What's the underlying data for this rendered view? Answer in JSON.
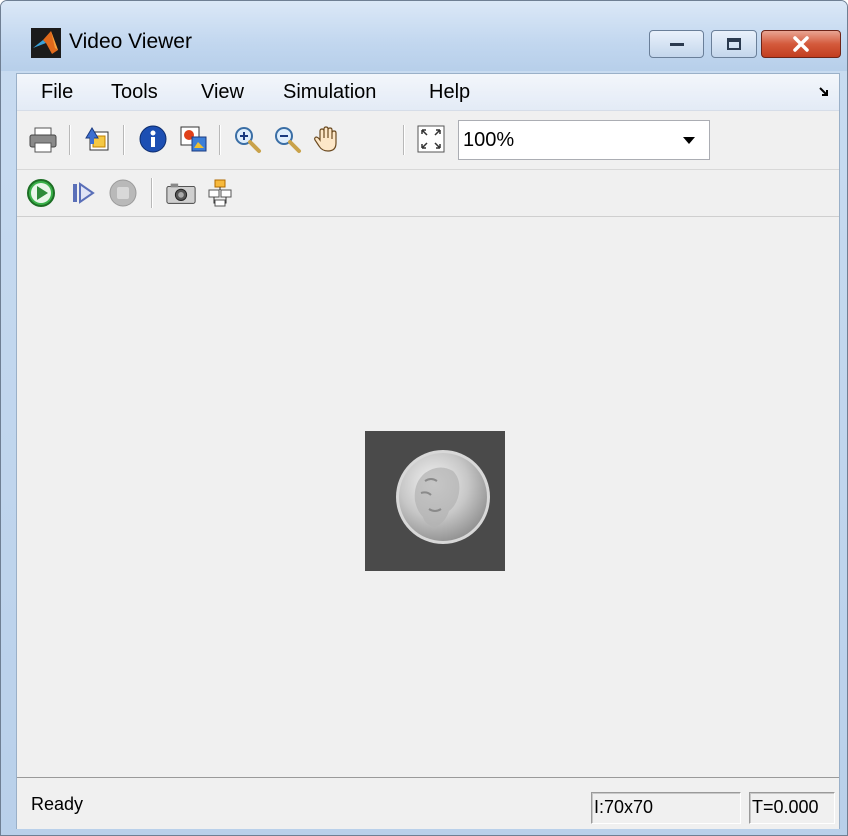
{
  "window": {
    "title": "Video Viewer",
    "minimize_icon": "minimize-icon",
    "maximize_icon": "maximize-icon",
    "close_icon": "close-icon"
  },
  "menu": {
    "items": [
      "File",
      "Tools",
      "View",
      "Simulation",
      "Help"
    ]
  },
  "toolbar": {
    "icons": [
      "print-icon",
      "parameters-icon",
      "info-icon",
      "export-image-icon",
      "zoom-in-icon",
      "zoom-out-icon",
      "pan-hand-icon",
      "fit-to-view-icon"
    ],
    "zoom_value": "100%"
  },
  "playback": {
    "icons": [
      "play-icon",
      "step-forward-icon",
      "stop-icon",
      "snapshot-icon",
      "highlight-block-icon"
    ]
  },
  "status": {
    "text": "Ready",
    "image_size": "I:70x70",
    "time": "T=0.000"
  },
  "colors": {
    "titlebar": "#c2d7ef",
    "close_button": "#c9472a",
    "play_green": "#2ea043",
    "client_bg": "#f0f0f0"
  }
}
